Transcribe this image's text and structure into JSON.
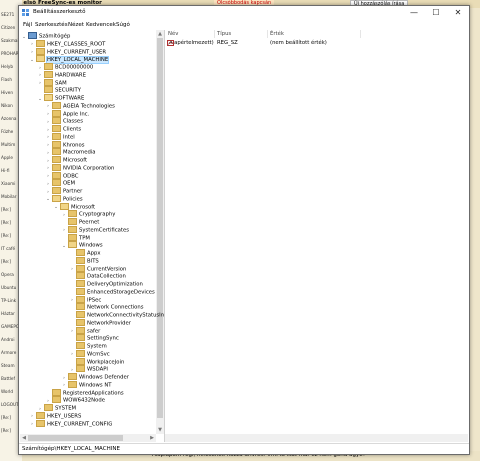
{
  "background": {
    "top_title": "Az első FreeSync-es monitor",
    "top_banner": "Olcsóbbodás kapcsán",
    "top_tab": "Új hozzászólás írása",
    "left_lines": [
      "SE271",
      "Citizen",
      "Szakmai",
      "PROHAR",
      "Helyb",
      "Flash",
      "Hiven",
      "Nikon",
      "Azonna",
      "Fűzhe",
      "Multim",
      "Apple",
      "Hi-fi",
      "Xiaomi",
      "Mobilar",
      "[Re:]",
      "[Re:]",
      "[Re:]",
      "IT café",
      "[Re:]",
      "Opera",
      "Ubuntu",
      "TP-Link",
      "Háztar",
      "GAMEPO",
      "Androi",
      "Armore",
      "Steam",
      "Battlef",
      "World",
      "LOGOUT",
      "[Re:]",
      "[Re:]"
    ],
    "bottom_text": "Alaplapom régi, hincsenek hozzá drivrek. Vmi tö ikát már ez nem gond ugye?"
  },
  "window": {
    "title": "Beállításszerkesztő",
    "minimize_label": "—",
    "maximize_label": "☐",
    "close_label": "✕",
    "menu": [
      "Fájl",
      "Szerkesztés",
      "Nézet",
      "Kedvencek",
      "Súgó"
    ],
    "status_path": "Számítógép\\HKEY_LOCAL_MACHINE"
  },
  "tree": [
    {
      "label": "Számítógép",
      "depth": 0,
      "exp": "⌄",
      "kind": "pc"
    },
    {
      "label": "HKEY_CLASSES_ROOT",
      "depth": 1,
      "exp": "›"
    },
    {
      "label": "HKEY_CURRENT_USER",
      "depth": 1,
      "exp": "›"
    },
    {
      "label": "HKEY_LOCAL_MACHINE",
      "depth": 1,
      "exp": "⌄",
      "open": true,
      "selected": true
    },
    {
      "label": "BCD00000000",
      "depth": 2,
      "exp": "›"
    },
    {
      "label": "HARDWARE",
      "depth": 2,
      "exp": "›"
    },
    {
      "label": "SAM",
      "depth": 2,
      "exp": "›"
    },
    {
      "label": "SECURITY",
      "depth": 2,
      "exp": ""
    },
    {
      "label": "SOFTWARE",
      "depth": 2,
      "exp": "⌄",
      "open": true
    },
    {
      "label": "AGEIA Technologies",
      "depth": 3,
      "exp": "›"
    },
    {
      "label": "Apple Inc.",
      "depth": 3,
      "exp": "›"
    },
    {
      "label": "Classes",
      "depth": 3,
      "exp": "›"
    },
    {
      "label": "Clients",
      "depth": 3,
      "exp": "›"
    },
    {
      "label": "Intel",
      "depth": 3,
      "exp": "›"
    },
    {
      "label": "Khronos",
      "depth": 3,
      "exp": "›"
    },
    {
      "label": "Macromedia",
      "depth": 3,
      "exp": "›"
    },
    {
      "label": "Microsoft",
      "depth": 3,
      "exp": "›"
    },
    {
      "label": "NVIDIA Corporation",
      "depth": 3,
      "exp": "›"
    },
    {
      "label": "ODBC",
      "depth": 3,
      "exp": "›"
    },
    {
      "label": "OEM",
      "depth": 3,
      "exp": "›"
    },
    {
      "label": "Partner",
      "depth": 3,
      "exp": "›"
    },
    {
      "label": "Policies",
      "depth": 3,
      "exp": "⌄",
      "open": true
    },
    {
      "label": "Microsoft",
      "depth": 4,
      "exp": "⌄",
      "open": true
    },
    {
      "label": "Cryptography",
      "depth": 5,
      "exp": "›"
    },
    {
      "label": "Peernet",
      "depth": 5,
      "exp": ""
    },
    {
      "label": "SystemCertificates",
      "depth": 5,
      "exp": "›"
    },
    {
      "label": "TPM",
      "depth": 5,
      "exp": ""
    },
    {
      "label": "Windows",
      "depth": 5,
      "exp": "⌄",
      "open": true
    },
    {
      "label": "Appx",
      "depth": 6,
      "exp": ""
    },
    {
      "label": "BITS",
      "depth": 6,
      "exp": ""
    },
    {
      "label": "CurrentVersion",
      "depth": 6,
      "exp": "›"
    },
    {
      "label": "DataCollection",
      "depth": 6,
      "exp": ""
    },
    {
      "label": "DeliveryOptimization",
      "depth": 6,
      "exp": ""
    },
    {
      "label": "EnhancedStorageDevices",
      "depth": 6,
      "exp": ""
    },
    {
      "label": "IPSec",
      "depth": 6,
      "exp": "›"
    },
    {
      "label": "Network Connections",
      "depth": 6,
      "exp": ""
    },
    {
      "label": "NetworkConnectivityStatusInd",
      "depth": 6,
      "exp": ""
    },
    {
      "label": "NetworkProvider",
      "depth": 6,
      "exp": ""
    },
    {
      "label": "safer",
      "depth": 6,
      "exp": "›"
    },
    {
      "label": "SettingSync",
      "depth": 6,
      "exp": ""
    },
    {
      "label": "System",
      "depth": 6,
      "exp": ""
    },
    {
      "label": "WcmSvc",
      "depth": 6,
      "exp": "›"
    },
    {
      "label": "WorkplaceJoin",
      "depth": 6,
      "exp": ""
    },
    {
      "label": "WSDAPI",
      "depth": 6,
      "exp": "›"
    },
    {
      "label": "Windows Defender",
      "depth": 5,
      "exp": "›"
    },
    {
      "label": "Windows NT",
      "depth": 5,
      "exp": "›"
    },
    {
      "label": "RegisteredApplications",
      "depth": 3,
      "exp": ""
    },
    {
      "label": "WOW6432Node",
      "depth": 3,
      "exp": "›"
    },
    {
      "label": "SYSTEM",
      "depth": 2,
      "exp": "›"
    },
    {
      "label": "HKEY_USERS",
      "depth": 1,
      "exp": "›"
    },
    {
      "label": "HKEY_CURRENT_CONFIG",
      "depth": 1,
      "exp": "›"
    }
  ],
  "values_pane": {
    "col_name": "Név",
    "col_type": "Típus",
    "col_data": "Érték",
    "rows": [
      {
        "name": "(Alapértelmezett)",
        "type": "REG_SZ",
        "data": "(nem beállított érték)",
        "icon": "ab"
      }
    ]
  }
}
